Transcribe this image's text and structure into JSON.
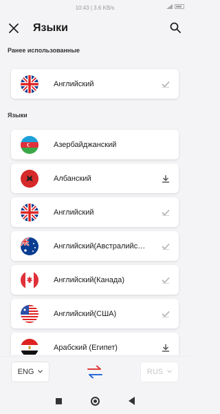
{
  "status_bar": {
    "time_speed": "10:43 | 3.6 KB/s"
  },
  "header": {
    "title": "Языки"
  },
  "sections": {
    "previous_label": "Ранее использованные",
    "languages_label": "Языки"
  },
  "previous": [
    {
      "name": "Английский",
      "flag": "uk",
      "status": "check"
    }
  ],
  "languages": [
    {
      "name": "Азербайджанский",
      "flag": "az",
      "status": "none"
    },
    {
      "name": "Албанский",
      "flag": "al",
      "status": "download"
    },
    {
      "name": "Английский",
      "flag": "uk",
      "status": "check"
    },
    {
      "name": "Английский(Австралийс…",
      "flag": "au",
      "status": "check"
    },
    {
      "name": "Английский(Канада)",
      "flag": "ca",
      "status": "check"
    },
    {
      "name": "Английский(США)",
      "flag": "us",
      "status": "check"
    },
    {
      "name": "Арабский (Египет)",
      "flag": "eg",
      "status": "download"
    }
  ],
  "bottom_bar": {
    "source_lang": "ENG",
    "target_lang": "RUS"
  },
  "colors": {
    "check": "#b0b0b0",
    "download": "#555555",
    "swap_red": "#e03a3a",
    "swap_blue": "#2a6ad8"
  }
}
